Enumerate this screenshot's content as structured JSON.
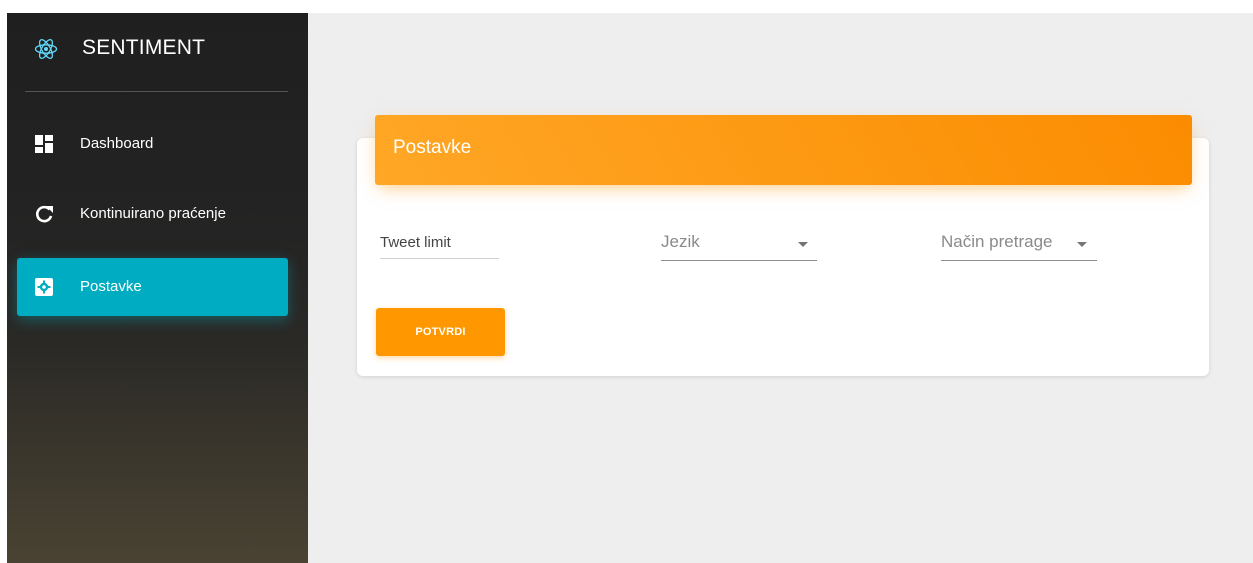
{
  "brand": {
    "name": "SENTIMENT",
    "logo_icon": "react-atom-icon"
  },
  "sidebar": {
    "items": [
      {
        "label": "Dashboard",
        "icon": "dashboard-icon",
        "active": false
      },
      {
        "label": "Kontinuirano praćenje",
        "icon": "refresh-icon",
        "active": false
      },
      {
        "label": "Postavke",
        "icon": "settings-icon",
        "active": true
      }
    ]
  },
  "settings_card": {
    "title": "Postavke",
    "tweet_limit": {
      "placeholder": "Tweet limit",
      "value": ""
    },
    "language_select": {
      "label": "Jezik"
    },
    "search_mode_select": {
      "label": "Način pretrage"
    },
    "submit_label": "POTVRDI"
  },
  "colors": {
    "accent_orange": "#ff9800",
    "active_nav": "#00acc1",
    "sidebar_bg": "#222222",
    "content_bg": "#eeeeee"
  }
}
